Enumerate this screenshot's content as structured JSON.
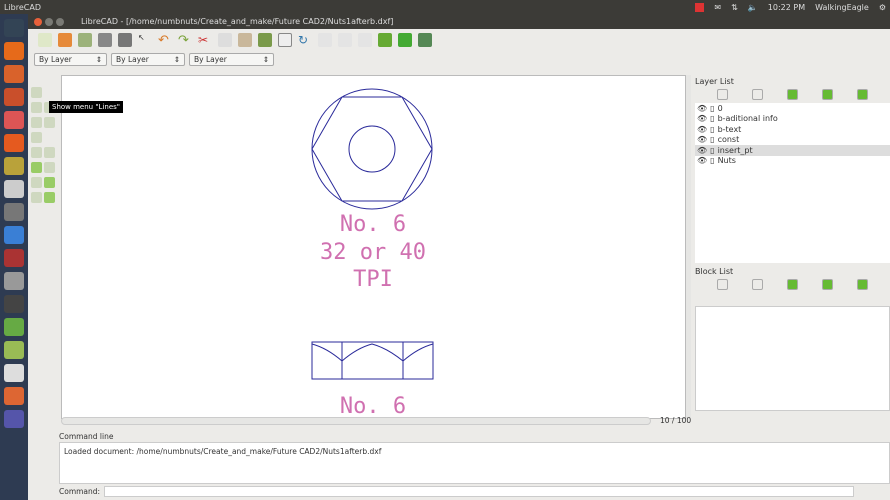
{
  "topbar": {
    "app": "LibreCAD",
    "time": "10:22 PM",
    "user": "WalkingEagle"
  },
  "window": {
    "title": "LibreCAD - [/home/numbnuts/Create_and_make/Future CAD2/Nuts1afterb.dxf]"
  },
  "combos": [
    "By Layer",
    "By Layer",
    "By Layer"
  ],
  "tooltip": "Show menu \"Lines\"",
  "drawing": {
    "line1": "No. 6",
    "line2": "32 or 40",
    "line3": "TPI",
    "line4": "No. 6",
    "color_text": "#d070b0",
    "color_lines": "#2a2a9a"
  },
  "page_indicator": "10 / 100",
  "layer_list": {
    "title": "Layer List",
    "layers": [
      "0",
      "b-aditional info",
      "b-text",
      "const",
      "insert_pt",
      "Nuts"
    ],
    "selected": "insert_pt"
  },
  "block_list": {
    "title": "Block List"
  },
  "command": {
    "title": "Command line",
    "output": "Loaded document: /home/numbnuts/Create_and_make/Future CAD2/Nuts1afterb.dxf",
    "prompt": "Command:"
  }
}
